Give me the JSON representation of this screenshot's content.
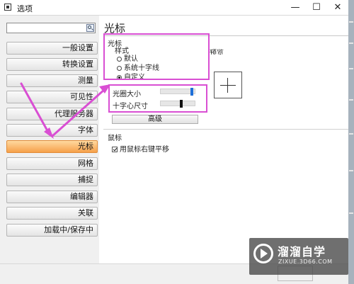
{
  "window": {
    "title": "选项",
    "buttons": [
      "—",
      "☐",
      "✕"
    ]
  },
  "sidebar": {
    "search_value": "",
    "items": [
      {
        "label": "一般设置"
      },
      {
        "label": "转换设置"
      },
      {
        "label": "测量"
      },
      {
        "label": "可见性"
      },
      {
        "label": "代理服务器"
      },
      {
        "label": "字体"
      },
      {
        "label": "光标",
        "selected": true
      },
      {
        "label": "网格"
      },
      {
        "label": "捕捉"
      },
      {
        "label": "编辑器"
      },
      {
        "label": "关联"
      },
      {
        "label": "加载中/保存中"
      }
    ]
  },
  "panel": {
    "title": "光标",
    "cursor_group": "光标",
    "style_label": "样式",
    "radios": [
      {
        "label": "默认",
        "checked": false
      },
      {
        "label": "系统十字线",
        "checked": false
      },
      {
        "label": "自定义",
        "checked": true
      }
    ],
    "preview_label": "预览",
    "sliders": [
      {
        "label": "光圈大小",
        "level": 0.95,
        "thumb_color": "#1e6fd9"
      },
      {
        "label": "十字心尺寸",
        "level": 0.62,
        "thumb_color": "#111111"
      }
    ],
    "advanced_button": "高级",
    "mouse_group": "鼠标",
    "pan_checkbox": {
      "label": "用鼠标右键平移",
      "checked": true
    }
  },
  "watermark": {
    "title": "溜溜自学",
    "url": "ZIXUE.3D66.COM"
  },
  "colors": {
    "selected_item": "#f6a04a",
    "annotation": "#d94fd3",
    "slider_blue": "#1e6fd9"
  }
}
